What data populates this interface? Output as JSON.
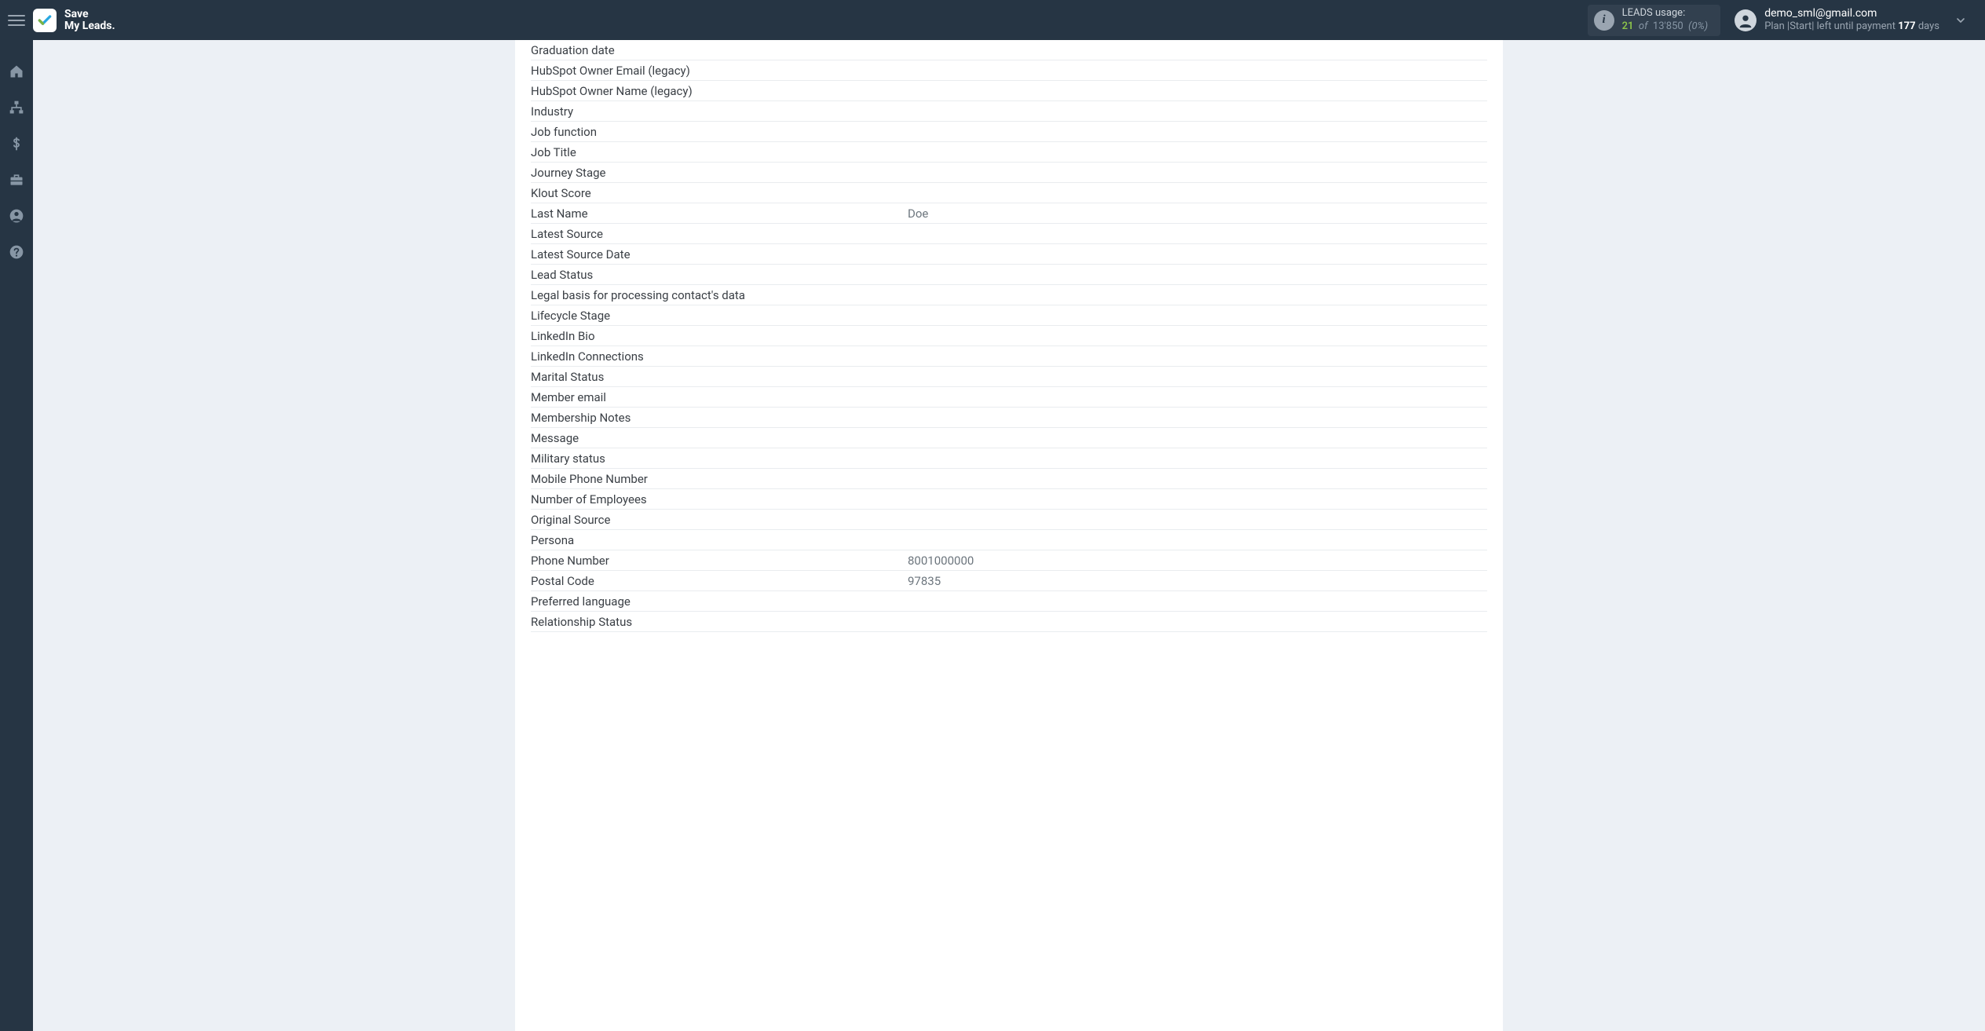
{
  "brand": {
    "line1": "Save",
    "line2": "My Leads."
  },
  "usage": {
    "title": "LEADS usage:",
    "used": "21",
    "of_word": "of",
    "total": "13'850",
    "percent": "(0%)"
  },
  "account": {
    "email": "demo_sml@gmail.com",
    "plan_prefix": "Plan |Start| left until payment ",
    "days": "177",
    "days_word": " days"
  },
  "sidebar_icons": [
    "home",
    "sitemap",
    "dollar",
    "briefcase",
    "user",
    "help"
  ],
  "fields": [
    {
      "label": "Graduation date",
      "value": ""
    },
    {
      "label": "HubSpot Owner Email (legacy)",
      "value": ""
    },
    {
      "label": "HubSpot Owner Name (legacy)",
      "value": ""
    },
    {
      "label": "Industry",
      "value": ""
    },
    {
      "label": "Job function",
      "value": ""
    },
    {
      "label": "Job Title",
      "value": ""
    },
    {
      "label": "Journey Stage",
      "value": ""
    },
    {
      "label": "Klout Score",
      "value": ""
    },
    {
      "label": "Last Name",
      "value": "Doe"
    },
    {
      "label": "Latest Source",
      "value": ""
    },
    {
      "label": "Latest Source Date",
      "value": ""
    },
    {
      "label": "Lead Status",
      "value": ""
    },
    {
      "label": "Legal basis for processing contact's data",
      "value": ""
    },
    {
      "label": "Lifecycle Stage",
      "value": ""
    },
    {
      "label": "LinkedIn Bio",
      "value": ""
    },
    {
      "label": "LinkedIn Connections",
      "value": ""
    },
    {
      "label": "Marital Status",
      "value": ""
    },
    {
      "label": "Member email",
      "value": ""
    },
    {
      "label": "Membership Notes",
      "value": ""
    },
    {
      "label": "Message",
      "value": ""
    },
    {
      "label": "Military status",
      "value": ""
    },
    {
      "label": "Mobile Phone Number",
      "value": ""
    },
    {
      "label": "Number of Employees",
      "value": ""
    },
    {
      "label": "Original Source",
      "value": ""
    },
    {
      "label": "Persona",
      "value": ""
    },
    {
      "label": "Phone Number",
      "value": "8001000000"
    },
    {
      "label": "Postal Code",
      "value": "97835"
    },
    {
      "label": "Preferred language",
      "value": ""
    },
    {
      "label": "Relationship Status",
      "value": ""
    }
  ]
}
